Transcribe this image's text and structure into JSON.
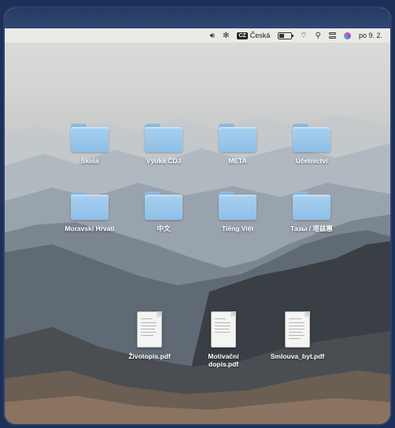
{
  "menubar": {
    "input_source": "Česká",
    "input_badge": "CZ",
    "clock": "po 9. 2."
  },
  "folders": [
    {
      "label": "Škola"
    },
    {
      "label": "Výuka ČDJ"
    },
    {
      "label": "META"
    },
    {
      "label": "Účetnictví"
    },
    {
      "label": "Moravskí Hrvati"
    },
    {
      "label": "中文"
    },
    {
      "label": "Tiếng Việt"
    },
    {
      "label": "Тазы / 塔兹惠"
    }
  ],
  "files": [
    {
      "label": "Životopis.pdf"
    },
    {
      "label_line1": "Motivační",
      "label_line2": "dopis.pdf"
    },
    {
      "label": "Smlouva_byt.pdf"
    }
  ],
  "icons": {
    "volume": "volume-icon",
    "bluetooth": "bluetooth-icon",
    "battery": "battery-icon",
    "wifi": "wifi-icon",
    "search": "spotlight-search-icon",
    "control_center": "control-center-icon",
    "siri": "siri-icon"
  }
}
